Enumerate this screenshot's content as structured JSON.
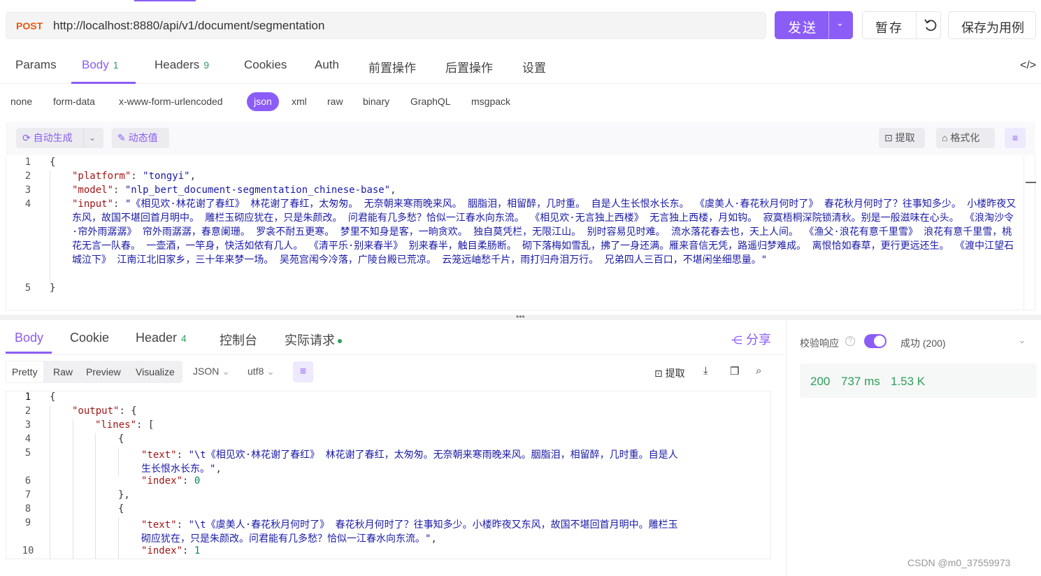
{
  "request": {
    "method": "POST",
    "url": "http://localhost:8880/api/v1/document/segmentation",
    "send_label": "发送",
    "save_label": "暂存",
    "save_example_label": "保存为用例"
  },
  "request_tabs": [
    {
      "label": "Params",
      "count": ""
    },
    {
      "label": "Body",
      "count": "1"
    },
    {
      "label": "Headers",
      "count": "9"
    },
    {
      "label": "Cookies",
      "count": ""
    },
    {
      "label": "Auth",
      "count": ""
    },
    {
      "label": "前置操作",
      "count": ""
    },
    {
      "label": "后置操作",
      "count": ""
    },
    {
      "label": "设置",
      "count": ""
    }
  ],
  "body_types": [
    "none",
    "form-data",
    "x-www-form-urlencoded",
    "json",
    "xml",
    "raw",
    "binary",
    "GraphQL",
    "msgpack"
  ],
  "body_toolbar": {
    "autogen": "自动生成",
    "dynamic": "动态值",
    "extract": "提取",
    "format": "格式化"
  },
  "request_body": {
    "line_numbers": [
      "1",
      "2",
      "3",
      "4",
      "5"
    ],
    "open": "{",
    "close": "}",
    "platform_key": "\"platform\"",
    "platform_value": "\"tongyi\"",
    "model_key": "\"model\"",
    "model_value": "\"nlp_bert_document-segmentation_chinese-base\"",
    "input_key": "\"input\"",
    "input_value": "\"《相见欢·林花谢了春红》 林花谢了春红，太匆匆。 无奈朝来寒雨晚来风。 胭脂泪，相留醉，几时重。 自是人生长恨水长东。 《虞美人·春花秋月何时了》 春花秋月何时了？往事知多少。 小楼昨夜又东风，故国不堪回首月明中。 雕栏玉砌应犹在，只是朱颜改。 问君能有几多愁？恰似一江春水向东流。 《相见欢·无言独上西楼》 无言独上西楼，月如钩。 寂寞梧桐深院锁清秋。别是一般滋味在心头。 《浪淘沙令·帘外雨潺潺》 帘外雨潺潺，春意阑珊。 罗衾不耐五更寒。 梦里不知身是客，一晌贪欢。 独自莫凭栏，无限江山。 别时容易见时难。 流水落花春去也，天上人间。 《渔父·浪花有意千里雪》 浪花有意千里雪，桃花无言一队春。 一壶酒，一竿身，快活如侬有几人。 《清平乐·别来春半》 别来春半，触目柔肠断。 砌下落梅如雪乱，拂了一身还满。雁来音信无凭，路遥归梦难成。 离恨恰如春草，更行更远还生。 《渡中江望石城泣下》 江南江北旧家乡，三十年来梦一场。 吴苑宫闱今冷落，广陵台殿已荒凉。 云笼远岫愁千片，雨打归舟泪万行。 兄弟四人三百口，不堪闲坐细思量。\""
  },
  "response_tabs": {
    "body": "Body",
    "cookie": "Cookie",
    "header": "Header",
    "header_count": "4",
    "console": "控制台",
    "actual": "实际请求",
    "share": "分享"
  },
  "response_toolbar": {
    "views": [
      "Pretty",
      "Raw",
      "Preview",
      "Visualize"
    ],
    "format": "JSON",
    "encoding": "utf8",
    "extract": "提取"
  },
  "response_body": {
    "line_numbers": [
      "1",
      "2",
      "3",
      "4",
      "5",
      "",
      "6",
      "7",
      "8",
      "9",
      "",
      "10"
    ],
    "l1": "{",
    "output_key": "\"output\"",
    "lines_key": "\"lines\"",
    "text_key": "\"text\"",
    "index_key": "\"index\"",
    "text1_a": "\"\\t《相见欢·林花谢了春红》 林花谢了春红，太匆匆。无奈朝来寒雨晚来风。胭脂泪，相留醉，几时重。自是人",
    "text1_b": "生长恨水长东。\"",
    "index1": "0",
    "text2_a": "\"\\t《虞美人·春花秋月何时了》 春花秋月何时了？往事知多少。小楼昨夜又东风，故国不堪回首月明中。雕栏玉",
    "text2_b": "砌应犹在，只是朱颜改。问君能有几多愁？恰似一江春水向东流。\"",
    "index2": "1"
  },
  "validation": {
    "label": "校验响应",
    "status_text": "成功 (200)",
    "enabled": true
  },
  "stats": {
    "status": "200",
    "time": "737 ms",
    "size": "1.53 K"
  },
  "watermark": "CSDN @m0_37559973",
  "colors": {
    "accent": "#8b5cf6",
    "method": "#e8590c",
    "success": "#2e9e5b",
    "json_key": "#a31515",
    "json_string": "#1a1aa6",
    "json_number": "#098658"
  }
}
